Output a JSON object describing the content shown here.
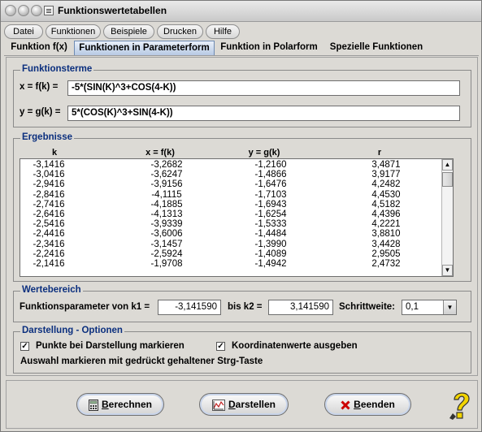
{
  "window": {
    "title": "Funktionswertetabellen"
  },
  "menu": [
    {
      "label": "Datei"
    },
    {
      "label": "Funktionen"
    },
    {
      "label": "Beispiele"
    },
    {
      "label": "Drucken"
    },
    {
      "label": "Hilfe"
    }
  ],
  "tabs": [
    {
      "label": "Funktion f(x)",
      "active": false
    },
    {
      "label": "Funktionen in Parameterform",
      "active": true
    },
    {
      "label": "Funktion in Polarform",
      "active": false
    },
    {
      "label": "Spezielle Funktionen",
      "active": false
    }
  ],
  "funktionsterme": {
    "legend": "Funktionsterme",
    "x_label": "x = f(k) =",
    "x_value": "-5*(SIN(K)^3+COS(4-K))",
    "y_label": "y = g(k) =",
    "y_value": "5*(COS(K)^3+SIN(4-K))"
  },
  "ergebnisse": {
    "legend": "Ergebnisse",
    "columns": [
      "k",
      "x = f(k)",
      "y = g(k)",
      "r"
    ],
    "rows": [
      [
        "-3,1416",
        "-3,2682",
        "-1,2160",
        "3,4871"
      ],
      [
        "-3,0416",
        "-3,6247",
        "-1,4866",
        "3,9177"
      ],
      [
        "-2,9416",
        "-3,9156",
        "-1,6476",
        "4,2482"
      ],
      [
        "-2,8416",
        "-4,1115",
        "-1,7103",
        "4,4530"
      ],
      [
        "-2,7416",
        "-4,1885",
        "-1,6943",
        "4,5182"
      ],
      [
        "-2,6416",
        "-4,1313",
        "-1,6254",
        "4,4396"
      ],
      [
        "-2,5416",
        "-3,9339",
        "-1,5333",
        "4,2221"
      ],
      [
        "-2,4416",
        "-3,6006",
        "-1,4484",
        "3,8810"
      ],
      [
        "-2,3416",
        "-3,1457",
        "-1,3990",
        "3,4428"
      ],
      [
        "-2,2416",
        "-2,5924",
        "-1,4089",
        "2,9505"
      ],
      [
        "-2,1416",
        "-1,9708",
        "-1,4942",
        "2,4732"
      ]
    ]
  },
  "wertebereich": {
    "legend": "Wertebereich",
    "von_label": "Funktionsparameter von k1 =",
    "k1": "-3,141590",
    "bis_label": "bis k2 =",
    "k2": "3,141590",
    "schritt_label": "Schrittweite:",
    "schritt_value": "0,1"
  },
  "darstellung": {
    "legend": "Darstellung - Optionen",
    "opt1": "Punkte bei Darstellung markieren",
    "opt1_checked": true,
    "opt2": "Koordinatenwerte ausgeben",
    "opt2_checked": true,
    "hint": "Auswahl markieren mit gedrückt gehaltener Strg-Taste"
  },
  "buttons": {
    "berechnen": {
      "u": "B",
      "rest": "erechnen"
    },
    "darstellen": {
      "u": "D",
      "rest": "arstellen"
    },
    "beenden": {
      "u": "B",
      "rest": "eenden"
    }
  },
  "colors": {
    "legend": "#0b2f7e",
    "tab_active": "#b7c9e3",
    "beenden_x": "#cc0000"
  }
}
